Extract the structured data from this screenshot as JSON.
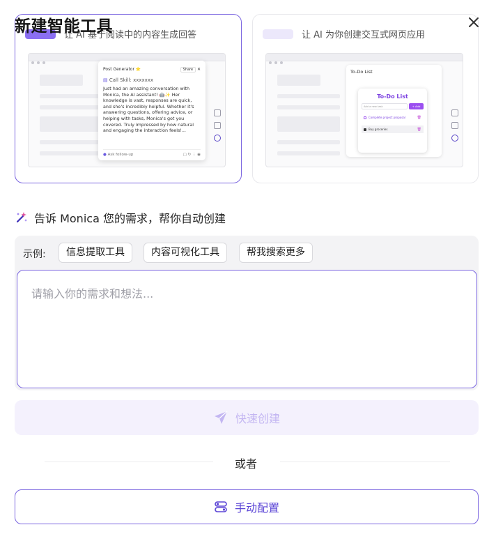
{
  "dialog": {
    "title": "新建智能工具",
    "close_icon": "close-icon"
  },
  "cards": {
    "left": {
      "header_partial": "让 AI 基于阅读中的内容生成回答",
      "preview": {
        "popup_title": "Post Generator ⭐",
        "share_label": "Share",
        "skill_label": "Call Skill: xxxxxxx",
        "body_text": "Just had an amazing conversation with Monica, the AI assistant! 🤖✨ Her knowledge is vast, responses are quick, and she's incredibly helpful. Whether it's answering questions, offering advice, or helping with tasks, Monica's got you covered. Truly impressed by how natural and engaging the interaction feels!...",
        "follow_up": "Ask follow-up"
      }
    },
    "right": {
      "header_partial": "让 AI 为你创建交互式网页应用",
      "preview": {
        "window_title": "To-Do List",
        "app_title": "To-Do List",
        "input_placeholder": "Add a new task",
        "add_label": "+ Add",
        "items": [
          {
            "text": "Complete project proposal",
            "done": false
          },
          {
            "text": "Buy groceries",
            "done": true
          }
        ]
      }
    }
  },
  "ai_section": {
    "icon": "magic-wand-icon",
    "heading": "告诉 Monica 您的需求，帮你自动创建",
    "examples_label": "示例:",
    "examples": [
      "信息提取工具",
      "内容可视化工具",
      "帮我搜索更多"
    ],
    "input_placeholder": "请输入你的需求和想法..."
  },
  "actions": {
    "quick_create": "快速创建",
    "quick_create_icon": "send-icon",
    "or_text": "或者",
    "manual_config": "手动配置",
    "manual_config_icon": "settings-toggle-icon"
  },
  "colors": {
    "accent": "#7b66e0",
    "accent_dark": "#5b45d6",
    "disabled_text": "#c3b6f2",
    "disabled_bg": "#f4f1fd"
  }
}
